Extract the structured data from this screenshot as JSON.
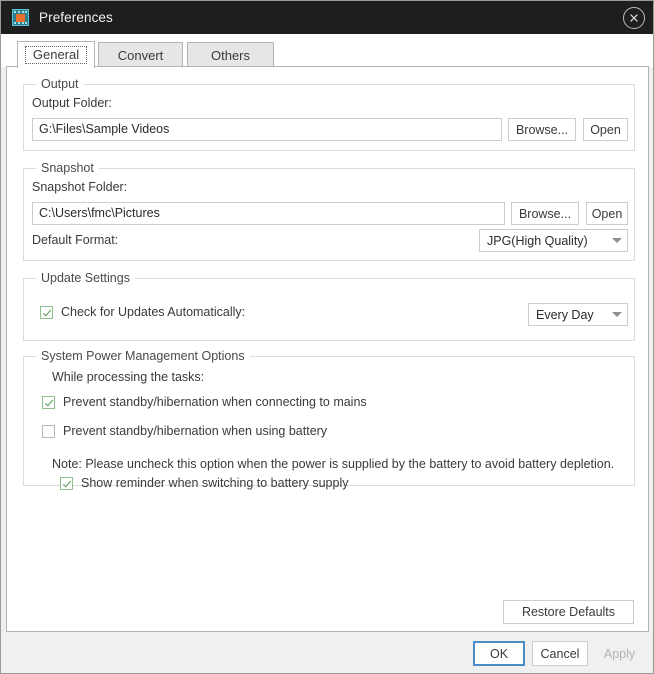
{
  "window": {
    "title": "Preferences",
    "icon": "video-film-icon",
    "close_icon": "close-circle-icon"
  },
  "tabs": [
    {
      "label": "General",
      "active": true
    },
    {
      "label": "Convert",
      "active": false
    },
    {
      "label": "Others",
      "active": false
    }
  ],
  "groups": {
    "output": {
      "title": "Output",
      "folder_label": "Output Folder:",
      "folder_value": "G:\\Files\\Sample Videos",
      "browse_label": "Browse...",
      "open_label": "Open"
    },
    "snapshot": {
      "title": "Snapshot",
      "folder_label": "Snapshot Folder:",
      "folder_value": "C:\\Users\\fmc\\Pictures",
      "browse_label": "Browse...",
      "open_label": "Open",
      "format_label": "Default Format:",
      "format_value": "JPG(High Quality)"
    },
    "update": {
      "title": "Update Settings",
      "check_label": "Check for Updates Automatically:",
      "check_checked": true,
      "frequency_value": "Every Day"
    },
    "power": {
      "title": "System Power Management Options",
      "intro": "While processing the tasks:",
      "mains_label": "Prevent standby/hibernation when connecting to mains",
      "mains_checked": true,
      "battery_label": "Prevent standby/hibernation when using battery",
      "battery_checked": false,
      "note": "Note: Please uncheck this option when the power is supplied by the battery to avoid battery depletion.",
      "reminder_label": "Show reminder when switching to battery supply",
      "reminder_checked": true
    }
  },
  "buttons": {
    "restore_defaults": "Restore Defaults",
    "ok": "OK",
    "cancel": "Cancel",
    "apply": "Apply"
  },
  "colors": {
    "titlebar_bg": "#1e1e1e",
    "accent_focus": "#4b8cc4",
    "check_green": "#4f9b4f",
    "panel_bg": "#ffffff",
    "dialog_bg": "#f0f0f0"
  }
}
